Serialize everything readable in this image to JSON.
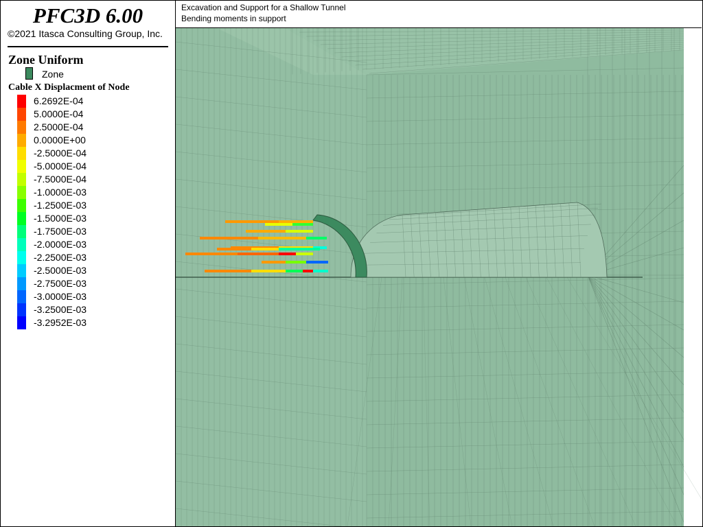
{
  "app": {
    "title": "PFC3D 6.00",
    "copyright": "©2021 Itasca Consulting Group, Inc."
  },
  "header": {
    "line1": "Excavation and Support for a Shallow Tunnel",
    "line2": "Bending moments in support"
  },
  "legend": {
    "zone_title": "Zone Uniform",
    "zone_label": "Zone",
    "zone_color": "#3c8a5f",
    "cable_title": "Cable X Displacment of Node",
    "ticks": [
      "6.2692E-04",
      "5.0000E-04",
      "2.5000E-04",
      "0.0000E+00",
      "-2.5000E-04",
      "-5.0000E-04",
      "-7.5000E-04",
      "-1.0000E-03",
      "-1.2500E-03",
      "-1.5000E-03",
      "-1.7500E-03",
      "-2.0000E-03",
      "-2.2500E-03",
      "-2.5000E-03",
      "-2.7500E-03",
      "-3.0000E-03",
      "-3.2500E-03",
      "-3.2952E-03"
    ],
    "colors": [
      "#ff0000",
      "#ff4500",
      "#ff7a00",
      "#ffab00",
      "#ffdd00",
      "#f0ff00",
      "#c2ff00",
      "#88ff00",
      "#3cff00",
      "#00ff22",
      "#00ff7a",
      "#00ffbb",
      "#00ffee",
      "#00ccff",
      "#0099ff",
      "#0066ff",
      "#0033ff",
      "#0000ff"
    ]
  },
  "model": {
    "background_color": "#8fbb9f",
    "mesh_color": "#5d7e6a",
    "shotcrete_color": "#3c8a5f"
  }
}
